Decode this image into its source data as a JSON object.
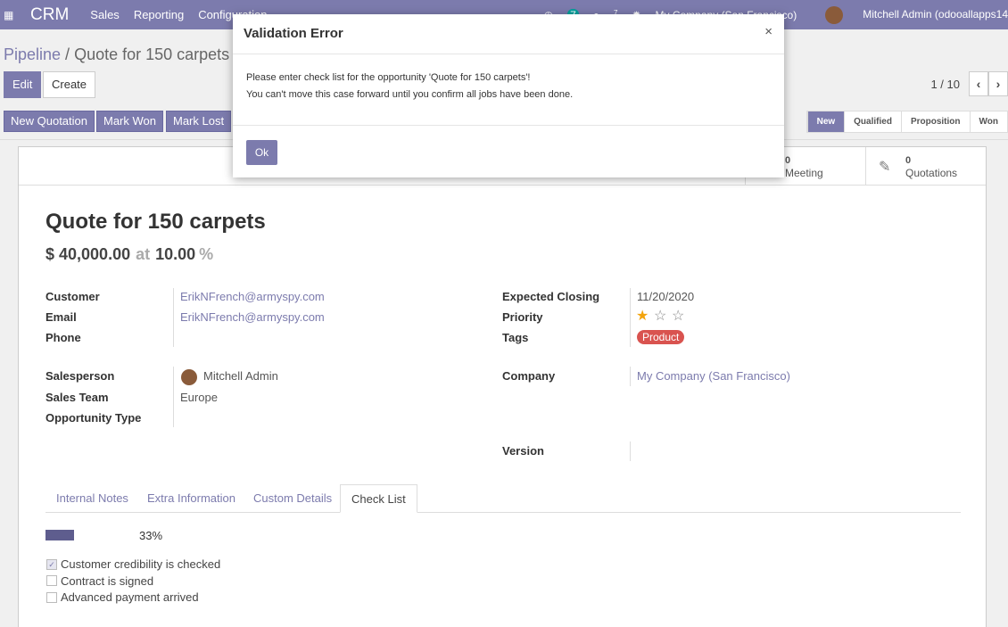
{
  "navbar": {
    "app": "CRM",
    "menus": [
      "Sales",
      "Reporting",
      "Configuration"
    ],
    "activity_count": "7",
    "message_count": "7",
    "company": "My Company (San Francisco)",
    "user": "Mitchell Admin (odooallapps14"
  },
  "control_panel": {
    "breadcrumb_parent": "Pipeline",
    "breadcrumb_sep": " / ",
    "breadcrumb_current": "Quote for 150 carpets",
    "edit_label": "Edit",
    "create_label": "Create",
    "pager": "1 / 10",
    "actions": [
      "New Quotation",
      "Mark Won",
      "Mark Lost"
    ],
    "stages": [
      "New",
      "Qualified",
      "Proposition",
      "Won"
    ]
  },
  "smart_buttons": [
    {
      "count": "0",
      "label": "Meeting"
    },
    {
      "count": "0",
      "label": "Quotations"
    }
  ],
  "record": {
    "title": "Quote for 150 carpets",
    "revenue": "$ 40,000.00",
    "at": "at",
    "probability": "10.00",
    "percent": "%",
    "customer_label": "Customer",
    "customer": "ErikNFrench@armyspy.com",
    "email_label": "Email",
    "email": "ErikNFrench@armyspy.com",
    "phone_label": "Phone",
    "salesperson_label": "Salesperson",
    "salesperson": "Mitchell Admin",
    "sales_team_label": "Sales Team",
    "sales_team": "Europe",
    "opportunity_type_label": "Opportunity Type",
    "expected_closing_label": "Expected Closing",
    "expected_closing": "11/20/2020",
    "priority_label": "Priority",
    "priority": 1,
    "priority_max": 3,
    "tags_label": "Tags",
    "tag": "Product",
    "company_label": "Company",
    "company": "My Company (San Francisco)",
    "version_label": "Version"
  },
  "tabs": [
    "Internal Notes",
    "Extra Information",
    "Custom Details",
    "Check List"
  ],
  "checklist": {
    "progress_text": "33%",
    "progress_value": 0.33,
    "items": [
      {
        "label": "Customer credibility is checked",
        "checked": true
      },
      {
        "label": "Contract is signed",
        "checked": false
      },
      {
        "label": "Advanced payment arrived",
        "checked": false
      }
    ]
  },
  "modal": {
    "title": "Validation Error",
    "close": "×",
    "line1": "Please enter check list for the opportunity 'Quote for 150 carpets'!",
    "line2": "You can't move this case forward until you confirm all jobs have been done.",
    "ok_label": "Ok"
  },
  "colors": {
    "brand": "#7c7bad",
    "tag": "#d9534f",
    "star": "#f3a40d"
  }
}
